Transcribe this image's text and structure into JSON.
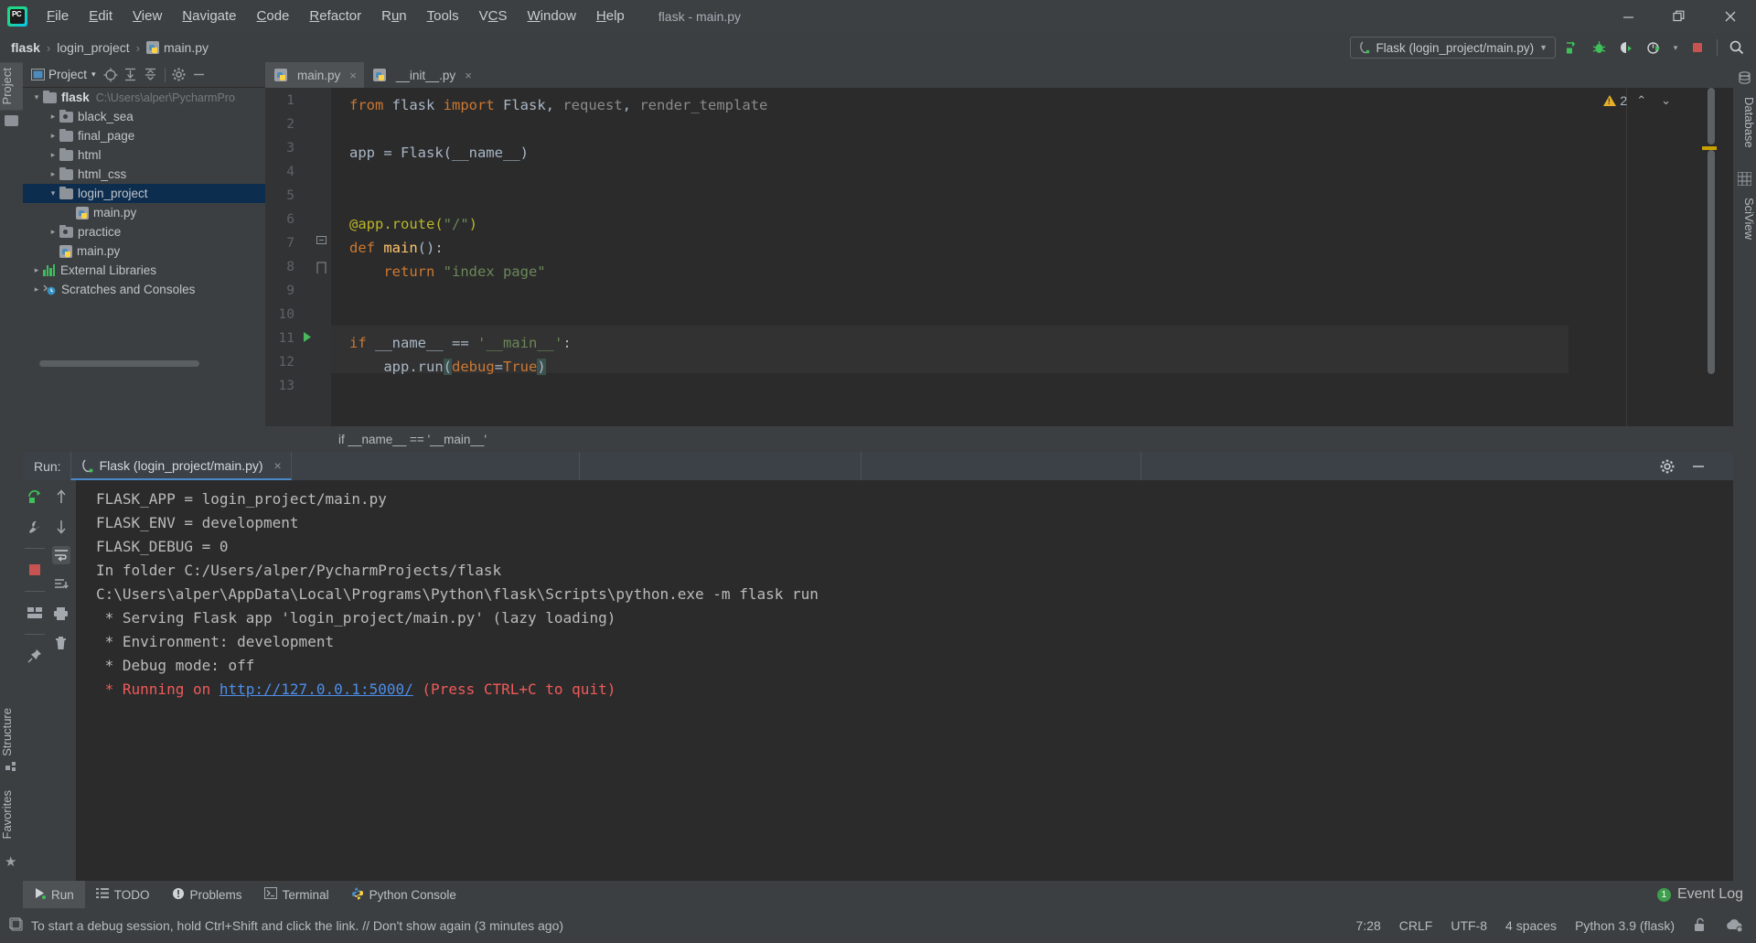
{
  "window": {
    "app_icon": "pycharm-logo-icon",
    "title": "flask - main.py",
    "menu": [
      "File",
      "Edit",
      "View",
      "Navigate",
      "Code",
      "Refactor",
      "Run",
      "Tools",
      "VCS",
      "Window",
      "Help"
    ],
    "controls": {
      "minimize": "minimize-icon",
      "maximize": "maximize-icon",
      "close": "close-icon"
    }
  },
  "breadcrumb": {
    "items": [
      {
        "label": "flask",
        "bold": true,
        "icon": null
      },
      {
        "label": "login_project",
        "bold": false,
        "icon": null
      },
      {
        "label": "main.py",
        "bold": false,
        "icon": "python-file-icon"
      }
    ],
    "separator": "›"
  },
  "toolbar": {
    "run_config": {
      "label": "Flask (login_project/main.py)",
      "icon": "flask-icon",
      "dropdown": "▼"
    },
    "buttons": [
      {
        "name": "run-button",
        "glyph": "run-icon"
      },
      {
        "name": "debug-button",
        "glyph": "debug-bug-icon"
      },
      {
        "name": "run-coverage-button",
        "glyph": "coverage-icon"
      },
      {
        "name": "profile-button",
        "glyph": "profile-icon"
      },
      {
        "name": "profile-dropdown",
        "glyph": "▾"
      },
      {
        "name": "stop-button",
        "glyph": "stop-icon"
      },
      {
        "name": "search-everywhere-button",
        "glyph": "search-icon"
      }
    ]
  },
  "left_tabs": [
    {
      "label": "Project",
      "active": true
    },
    {
      "label": "Structure",
      "active": false
    },
    {
      "label": "Favorites",
      "active": false
    }
  ],
  "right_tabs": [
    {
      "label": "Database",
      "active": false
    },
    {
      "label": "SciView",
      "active": false
    }
  ],
  "project_panel": {
    "title": "Project",
    "title_dropdown": "▾",
    "header_buttons": [
      "locate-target-icon",
      "expand-all-icon",
      "collapse-all-icon",
      "settings-gear-icon",
      "hide-panel-icon"
    ],
    "tree": [
      {
        "indent": 0,
        "arrow": "⌄",
        "type": "folder",
        "label": "flask",
        "bold": true,
        "path": "C:\\Users\\alper\\PycharmPro",
        "selected": false
      },
      {
        "indent": 1,
        "arrow": "›",
        "type": "folder-src",
        "label": "black_sea",
        "bold": false,
        "path": "",
        "selected": false
      },
      {
        "indent": 1,
        "arrow": "›",
        "type": "folder",
        "label": "final_page",
        "bold": false,
        "path": "",
        "selected": false
      },
      {
        "indent": 1,
        "arrow": "›",
        "type": "folder",
        "label": "html",
        "bold": false,
        "path": "",
        "selected": false
      },
      {
        "indent": 1,
        "arrow": "›",
        "type": "folder",
        "label": "html_css",
        "bold": false,
        "path": "",
        "selected": false
      },
      {
        "indent": 1,
        "arrow": "⌄",
        "type": "folder",
        "label": "login_project",
        "bold": false,
        "path": "",
        "selected": true
      },
      {
        "indent": 2,
        "arrow": "",
        "type": "python",
        "label": "main.py",
        "bold": false,
        "path": "",
        "selected": false
      },
      {
        "indent": 1,
        "arrow": "›",
        "type": "folder-src",
        "label": "practice",
        "bold": false,
        "path": "",
        "selected": false
      },
      {
        "indent": 1,
        "arrow": "",
        "type": "python",
        "label": "main.py",
        "bold": false,
        "path": "",
        "selected": false
      },
      {
        "indent": 0,
        "arrow": "›",
        "type": "library",
        "label": "External Libraries",
        "bold": false,
        "path": "",
        "selected": false
      },
      {
        "indent": 0,
        "arrow": "›",
        "type": "scratch",
        "label": "Scratches and Consoles",
        "bold": false,
        "path": "",
        "selected": false
      }
    ]
  },
  "editor": {
    "tabs": [
      {
        "label": "main.py",
        "icon": "python-file-icon",
        "active": true,
        "close": "×"
      },
      {
        "label": "__init__.py",
        "icon": "python-file-icon",
        "active": false,
        "close": "×"
      }
    ],
    "line_numbers": [
      "1",
      "2",
      "3",
      "4",
      "5",
      "6",
      "7",
      "8",
      "9",
      "10",
      "11",
      "12",
      "13"
    ],
    "lines": [
      {
        "n": 1,
        "tokens": [
          {
            "t": "from ",
            "c": "k"
          },
          {
            "t": "flask ",
            "c": "cls"
          },
          {
            "t": "import ",
            "c": "k"
          },
          {
            "t": "Flask",
            "c": "cls"
          },
          {
            "t": ", ",
            "c": "cls"
          },
          {
            "t": "request",
            "c": "dim"
          },
          {
            "t": ", ",
            "c": "cls"
          },
          {
            "t": "render_template",
            "c": "dim"
          }
        ]
      },
      {
        "n": 2,
        "tokens": []
      },
      {
        "n": 3,
        "tokens": [
          {
            "t": "app = Flask(__name__)",
            "c": "cls"
          }
        ]
      },
      {
        "n": 4,
        "tokens": []
      },
      {
        "n": 5,
        "tokens": []
      },
      {
        "n": 6,
        "tokens": [
          {
            "t": "@app.route(",
            "c": "dec"
          },
          {
            "t": "\"/\"",
            "c": "str"
          },
          {
            "t": ")",
            "c": "dec"
          }
        ]
      },
      {
        "n": 7,
        "tokens": [
          {
            "t": "def ",
            "c": "k"
          },
          {
            "t": "main",
            "c": "fn"
          },
          {
            "t": "():",
            "c": "cls"
          }
        ]
      },
      {
        "n": 8,
        "tokens": [
          {
            "t": "    ",
            "c": "cls"
          },
          {
            "t": "return ",
            "c": "k"
          },
          {
            "t": "\"index page\"",
            "c": "str"
          }
        ]
      },
      {
        "n": 9,
        "tokens": []
      },
      {
        "n": 10,
        "tokens": []
      },
      {
        "n": 11,
        "tokens": [
          {
            "t": "if ",
            "c": "k"
          },
          {
            "t": "__name__ == ",
            "c": "cls"
          },
          {
            "t": "'__main__'",
            "c": "str"
          },
          {
            "t": ":",
            "c": "cls"
          }
        ]
      },
      {
        "n": 12,
        "tokens": [
          {
            "t": "    app.run",
            "c": "cls"
          },
          {
            "t": "(",
            "c": "bracket"
          },
          {
            "t": "debug",
            "c": "k"
          },
          {
            "t": "=",
            "c": "cls"
          },
          {
            "t": "True",
            "c": "k"
          },
          {
            "t": ")",
            "c": "bracket"
          }
        ]
      },
      {
        "n": 13,
        "tokens": []
      }
    ],
    "fold_markers": [
      {
        "line": 7,
        "glyph": "⊖"
      },
      {
        "line": 8,
        "glyph": "⊖"
      }
    ],
    "run_marker_line": 11,
    "run_marker_glyph": "▶",
    "inspection": {
      "count": "2",
      "icon": "warning-triangle-icon",
      "up": "⌃",
      "down": "⌄"
    },
    "breadcrumb_bottom": "if __name__ == '__main__'"
  },
  "run_panel": {
    "label": "Run:",
    "tab": {
      "label": "Flask (login_project/main.py)",
      "icon": "flask-icon",
      "close": "×"
    },
    "header_buttons": [
      "settings-gear-icon",
      "hide-panel-icon"
    ],
    "side_buttons": [
      "rerun-icon",
      "wrench-icon",
      "stop-icon",
      "layout-icon",
      "pin-icon"
    ],
    "side_buttons2": [
      "up-arrow-icon",
      "down-arrow-icon",
      "soft-wrap-icon",
      "scroll-to-end-icon",
      "print-icon",
      "trash-icon"
    ],
    "console_lines": [
      {
        "segments": [
          {
            "t": "FLASK_APP = login_project/main.py",
            "c": "plain"
          }
        ]
      },
      {
        "segments": [
          {
            "t": "FLASK_ENV = development",
            "c": "plain"
          }
        ]
      },
      {
        "segments": [
          {
            "t": "FLASK_DEBUG = 0",
            "c": "plain"
          }
        ]
      },
      {
        "segments": [
          {
            "t": "In folder C:/Users/alper/PycharmProjects/flask",
            "c": "plain"
          }
        ]
      },
      {
        "segments": [
          {
            "t": "C:\\Users\\alper\\AppData\\Local\\Programs\\Python\\flask\\Scripts\\python.exe -m flask run",
            "c": "plain"
          }
        ]
      },
      {
        "segments": [
          {
            "t": " * Serving Flask app 'login_project/main.py' (lazy loading)",
            "c": "plain"
          }
        ]
      },
      {
        "segments": [
          {
            "t": " * Environment: development",
            "c": "plain"
          }
        ]
      },
      {
        "segments": [
          {
            "t": " * Debug mode: off",
            "c": "plain"
          }
        ]
      },
      {
        "segments": [
          {
            "t": " * Running on ",
            "c": "red"
          },
          {
            "t": "http://127.0.0.1:5000/",
            "c": "link"
          },
          {
            "t": " (Press CTRL+C to quit)",
            "c": "red"
          }
        ]
      }
    ]
  },
  "bottom_bar": {
    "tabs": [
      {
        "label": "Run",
        "icon": "run-green-icon",
        "active": true
      },
      {
        "label": "TODO",
        "icon": "todo-list-icon",
        "active": false
      },
      {
        "label": "Problems",
        "icon": "problems-icon",
        "active": false
      },
      {
        "label": "Terminal",
        "icon": "terminal-icon",
        "active": false
      },
      {
        "label": "Python Console",
        "icon": "python-console-icon",
        "active": false
      }
    ],
    "event_log": {
      "label": "Event Log",
      "count": "1"
    }
  },
  "status_bar": {
    "message": "To start a debug session, hold Ctrl+Shift and click the link. // Don't show again (3 minutes ago)",
    "message_icon": "notification-icon",
    "caret_position": "7:28",
    "line_separator": "CRLF",
    "encoding": "UTF-8",
    "indent": "4 spaces",
    "interpreter": "Python 3.9 (flask)",
    "lock_icon": "unlocked-icon",
    "cloud_icon": "cloud-sync-icon"
  }
}
